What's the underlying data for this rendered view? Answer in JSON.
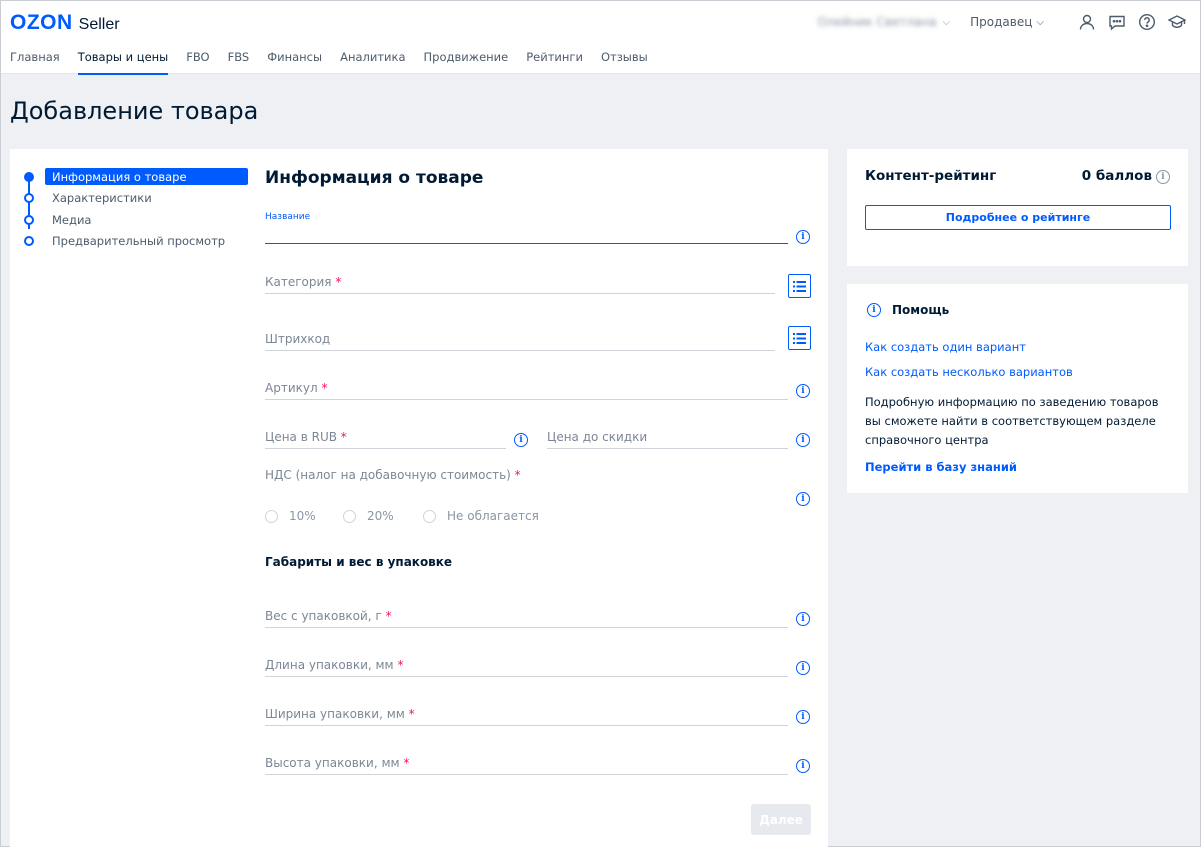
{
  "header": {
    "logo_brand": "OZON",
    "logo_product": "Seller",
    "username": "Олейник Светлана",
    "role": "Продавец",
    "icons": [
      "user-icon",
      "chat-icon",
      "help-icon",
      "education-icon"
    ]
  },
  "nav": {
    "items": [
      {
        "label": "Главная"
      },
      {
        "label": "Товары и цены",
        "active": true
      },
      {
        "label": "FBO"
      },
      {
        "label": "FBS"
      },
      {
        "label": "Финансы"
      },
      {
        "label": "Аналитика"
      },
      {
        "label": "Продвижение"
      },
      {
        "label": "Рейтинги"
      },
      {
        "label": "Отзывы"
      }
    ]
  },
  "page": {
    "title": "Добавление товара"
  },
  "steps": [
    {
      "label": "Информация о товаре",
      "active": true
    },
    {
      "label": "Характеристики"
    },
    {
      "label": "Медиа"
    },
    {
      "label": "Предварительный просмотр"
    }
  ],
  "form": {
    "title": "Информация о товаре",
    "name_label": "Название",
    "category_label": "Категория",
    "barcode_label": "Штрихкод",
    "article_label": "Артикул",
    "price_label": "Цена в RUB",
    "old_price_label": "Цена до скидки",
    "vat_label": "НДС (налог на добавочную стоимость)",
    "vat_options": [
      "10%",
      "20%",
      "Не облагается"
    ],
    "dimensions_title": "Габариты и вес в упаковке",
    "weight_label": "Вес с упаковкой, г",
    "length_label": "Длина упаковки, мм",
    "width_label": "Ширина упаковки, мм",
    "height_label": "Высота упаковки, мм",
    "required_mark": "*",
    "info_glyph": "i",
    "next_label": "Далее"
  },
  "rating": {
    "title": "Контент-рейтинг",
    "points": "0 баллов",
    "button_label": "Подробнее о рейтинге"
  },
  "help": {
    "title": "Помощь",
    "link_one": "Как создать один вариант",
    "link_many": "Как создать несколько вариантов",
    "text": "Подробную информацию по заведению товаров вы сможете найти в соответствующем разделе справочного центра",
    "kb_link": "Перейти в базу знаний"
  },
  "colors": {
    "accent": "#005bff",
    "required": "#f91155",
    "background": "#eef0f4"
  }
}
